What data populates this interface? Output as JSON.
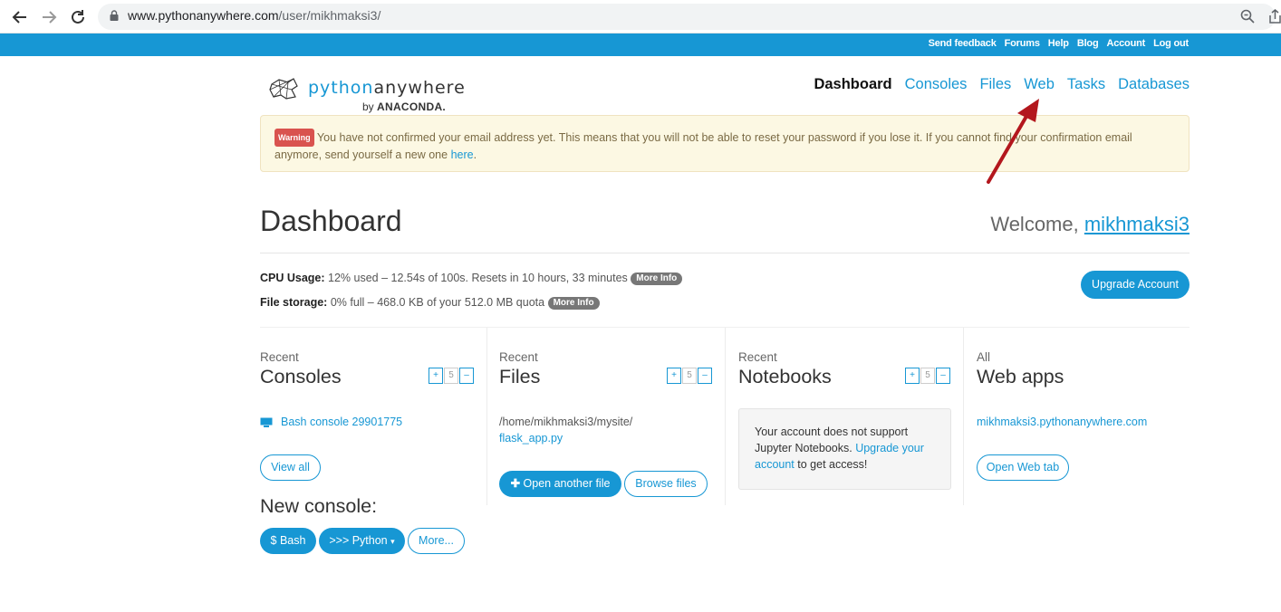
{
  "browser": {
    "url_host": "www.pythonanywhere.com",
    "url_path": "/user/mikhmaksi3/",
    "icons": [
      "back-arrow-icon",
      "forward-arrow-icon",
      "reload-icon",
      "lock-icon",
      "zoom-icon",
      "share-icon"
    ]
  },
  "topbar": {
    "links": [
      "Send feedback",
      "Forums",
      "Help",
      "Blog",
      "Account",
      "Log out"
    ]
  },
  "logo": {
    "python": "python",
    "anywhere": "anywhere",
    "by": "by",
    "anaconda": "ANACONDA."
  },
  "nav": {
    "items": [
      "Dashboard",
      "Consoles",
      "Files",
      "Web",
      "Tasks",
      "Databases"
    ],
    "active": "Dashboard"
  },
  "warning": {
    "badge": "Warning",
    "text": "You have not confirmed your email address yet. This means that you will not be able to reset your password if you lose it. If you cannot find your confirmation email anymore, send yourself a new one",
    "link": "here",
    "end": "."
  },
  "dashboard": {
    "title": "Dashboard",
    "welcome": "Welcome,",
    "username": "mikhmaksi3"
  },
  "usage": {
    "cpu_label": "CPU Usage:",
    "cpu_text": "12% used – 12.54s of 100s. Resets in 10 hours, 33 minutes",
    "storage_label": "File storage:",
    "storage_text": "0% full – 468.0 KB of your 512.0 MB quota",
    "more_info": "More Info",
    "upgrade": "Upgrade Account"
  },
  "columns": {
    "consoles": {
      "small": "Recent",
      "big": "Consoles",
      "item": "Bash console 29901775",
      "view_all": "View all"
    },
    "files": {
      "small": "Recent",
      "big": "Files",
      "path": "/home/mikhmaksi3/mysite/",
      "file": "flask_app.py",
      "open_btn": "Open another file",
      "browse_btn": "Browse files"
    },
    "notebooks": {
      "small": "Recent",
      "big": "Notebooks",
      "msg1": "Your account does not support Jupyter Notebooks.",
      "link": "Upgrade your account",
      "msg2": "to get access!"
    },
    "webapps": {
      "small": "All",
      "big": "Web apps",
      "app": "mikhmaksi3.pythonanywhere.com",
      "open_btn": "Open Web tab"
    },
    "stepper": {
      "plus": "+",
      "num": "5",
      "minus": "–"
    }
  },
  "new_console": {
    "title": "New console:",
    "bash": "$ Bash",
    "python": ">>> Python",
    "more": "More..."
  },
  "colors": {
    "brand_blue": "#1797d4",
    "warning_bg": "#fcf8e3",
    "arrow_red": "#b3171d"
  }
}
